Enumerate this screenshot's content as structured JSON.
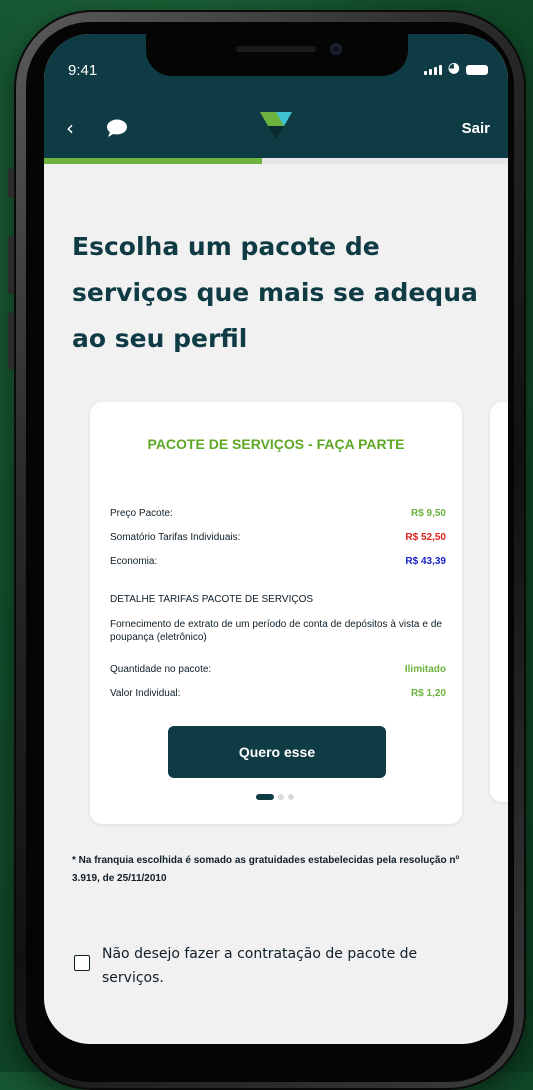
{
  "status_bar": {
    "time": "9:41"
  },
  "header": {
    "exit_label": "Sair"
  },
  "progress": {
    "value": 0.47
  },
  "page": {
    "title": "Escolha um pacote de serviços que mais se adequa ao seu perfil"
  },
  "card": {
    "title": "PACOTE DE SERVIÇOS - FAÇA PARTE",
    "rows": [
      {
        "label": "Preço Pacote:",
        "value": "R$ 9,50",
        "color": "#6db33f"
      },
      {
        "label": "Somatório Tarifas Individuais:",
        "value": "R$ 52,50",
        "color": "#e0241c"
      },
      {
        "label": "Economia:",
        "value": "R$ 43,39",
        "color": "#1a22c9"
      }
    ],
    "details_heading": "DETALHE TARIFAS PACOTE DE SERVIÇOS",
    "details_text": "Fornecimento de extrato de um período de conta de depósitos à vista e de poupança (eletrônico)",
    "detail_rows": [
      {
        "label": "Quantidade no pacote:",
        "value": "Ilimitado",
        "color": "#6db33f"
      },
      {
        "label": "Valor Individual:",
        "value": "R$ 1,20",
        "color": "#6db33f"
      }
    ],
    "cta_label": "Quero esse"
  },
  "carousel": {
    "active_index": 0,
    "count": 3
  },
  "footnote": "* Na franquia escolhida é somado as gratuidades estabelecidas pela resolução nº 3.919, de 25/11/2010",
  "opt_out": {
    "label": "Não desejo fazer a contratação de pacote de serviços.",
    "checked": false
  },
  "colors": {
    "primary": "#0f3b45",
    "accent": "#6db33f"
  }
}
